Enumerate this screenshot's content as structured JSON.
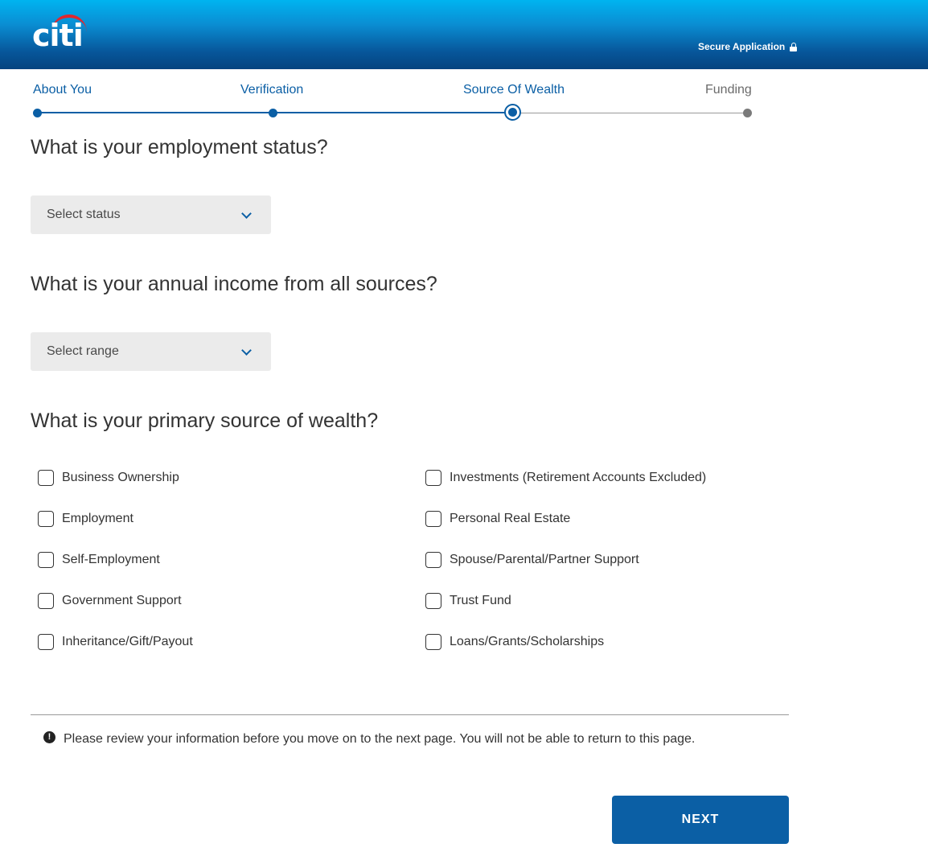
{
  "header": {
    "logo_text": "citi",
    "secure_label": "Secure Application",
    "secure_icon": "lock-icon"
  },
  "stepper": {
    "steps": [
      {
        "label": "About You",
        "state": "complete"
      },
      {
        "label": "Verification",
        "state": "complete"
      },
      {
        "label": "Source Of Wealth",
        "state": "current"
      },
      {
        "label": "Funding",
        "state": "upcoming"
      }
    ]
  },
  "employment": {
    "question": "What is your employment status?",
    "placeholder": "Select status"
  },
  "income": {
    "question": "What is your annual income from all sources?",
    "placeholder": "Select range"
  },
  "wealth": {
    "question": "What is your primary source of wealth?",
    "left_options": [
      "Business Ownership",
      "Employment",
      "Self-Employment",
      "Government Support",
      "Inheritance/Gift/Payout"
    ],
    "right_options": [
      "Investments (Retirement Accounts Excluded)",
      "Personal Real Estate",
      "Spouse/Parental/Partner Support",
      "Trust Fund",
      "Loans/Grants/Scholarships"
    ]
  },
  "notice": {
    "icon": "exclamation-icon",
    "text": "Please review your information before you move on to the next page. You will not be able to return to this page."
  },
  "actions": {
    "next_label": "NEXT"
  },
  "colors": {
    "brand_blue": "#0b5fa5",
    "citi_red": "#e3262d",
    "header_top": "#00b4f0",
    "header_bottom": "#05447f"
  }
}
